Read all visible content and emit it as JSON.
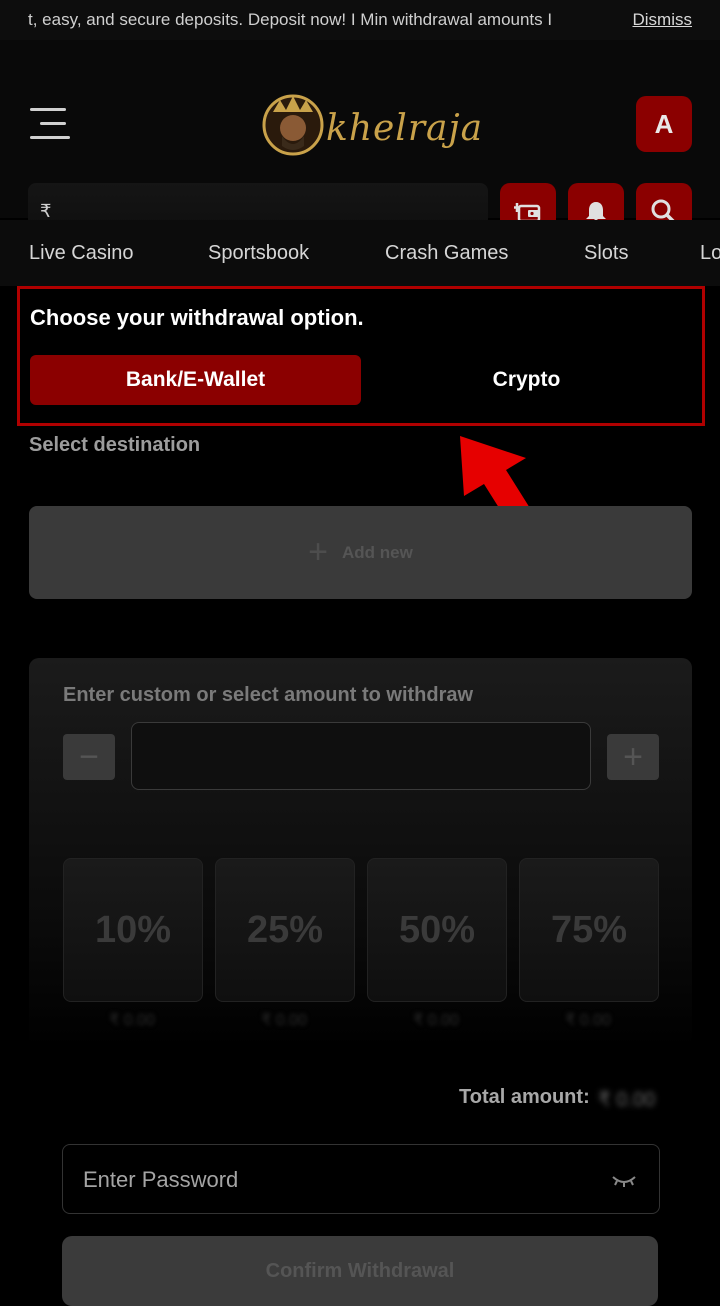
{
  "banner": {
    "ticker": "t, easy, and secure deposits. Deposit now!   I   Min withdrawal amounts I",
    "dismiss": "Dismiss"
  },
  "header": {
    "logo_text": "khelraja",
    "avatar_letter": "A",
    "balance_currency": "₹"
  },
  "nav": {
    "items": [
      "Live Casino",
      "Sportsbook",
      "Crash Games",
      "Slots",
      "Lo"
    ]
  },
  "withdraw_options": {
    "title": "Choose your withdrawal option.",
    "tabs": [
      "Bank/E-Wallet",
      "Crypto"
    ],
    "selected": "Bank/E-Wallet"
  },
  "destination": {
    "label": "Select destination",
    "add_new": "Add new"
  },
  "amount": {
    "label": "Enter custom or select amount to withdraw",
    "minus": "−",
    "plus": "+",
    "presets": [
      "10%",
      "25%",
      "50%",
      "75%"
    ],
    "preset_values": [
      "₹ 0.00",
      "₹ 0.00",
      "₹ 0.00",
      "₹ 0.00"
    ]
  },
  "total": {
    "label": "Total amount:",
    "value": "₹ 0.00"
  },
  "password": {
    "placeholder": "Enter Password"
  },
  "confirm": {
    "label": "Confirm Withdrawal"
  },
  "colors": {
    "accent": "#8b0000",
    "highlight_border": "#b00000",
    "arrow": "#e60000",
    "logo_gold": "#c9a24a"
  }
}
